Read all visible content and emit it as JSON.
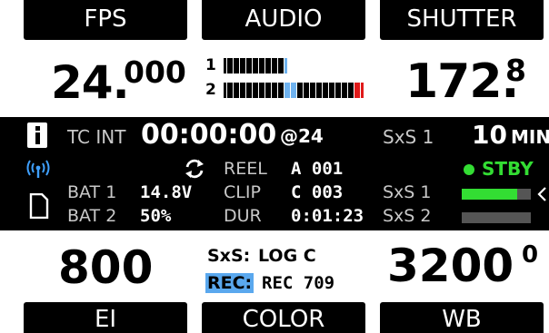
{
  "tabs": {
    "top": [
      "FPS",
      "AUDIO",
      "SHUTTER"
    ],
    "bottom": [
      "EI",
      "COLOR",
      "WB"
    ]
  },
  "fps": {
    "whole": "24.",
    "fraction": "000"
  },
  "shutter": {
    "whole": "172.",
    "fraction": "8"
  },
  "audio": {
    "channels": [
      {
        "label": "1",
        "segments": [
          "k",
          "k",
          "k",
          "k",
          "k",
          "k",
          "k",
          "k",
          "k",
          "k",
          "k",
          "k",
          "k",
          "k",
          "k",
          "k",
          "k",
          "k",
          "k",
          "b"
        ]
      },
      {
        "label": "2",
        "segments": [
          "k",
          "k",
          "k",
          "k",
          "k",
          "k",
          "k",
          "k",
          "k",
          "k",
          "k",
          "k",
          "k",
          "k",
          "k",
          "k",
          "k",
          "k",
          "k",
          "b",
          "b",
          "b",
          "b",
          "k",
          "k",
          "k",
          "k",
          "k",
          "k",
          "k",
          "k",
          "k",
          "k",
          "k",
          "k",
          "k",
          "k",
          "k",
          "k",
          "k",
          "k",
          "r",
          "r",
          "r"
        ]
      }
    ],
    "colors": {
      "k": "#000000",
      "b": "#6fb3f0",
      "r": "#e01a1a"
    }
  },
  "status": {
    "tc_label": "TC INT",
    "timecode": "00:00:00",
    "tc_rate": "@24",
    "media_1_label": "SxS 1",
    "remaining": "10",
    "remaining_unit": "MIN",
    "state": "STBY",
    "state_color": "#33dd33",
    "bat1_label": "BAT 1",
    "bat1_value": "14.8V",
    "bat2_label": "BAT 2",
    "bat2_value": "50%",
    "reel_label": "REEL",
    "reel_value": "A 001",
    "clip_label": "CLIP",
    "clip_value": "C 003",
    "dur_label": "DUR",
    "dur_value": "0:01:23",
    "card1_label": "SxS 1",
    "card2_label": "SxS 2",
    "card1_fill": 0.8,
    "card2_fill": 0.0,
    "wifi_color": "#3fa0ff",
    "info_icon": "info-icon",
    "sd_icon": "sd-card-icon",
    "sync_icon": "sync-icon"
  },
  "ei": {
    "value": "800"
  },
  "color": {
    "sxs_label": "SxS:",
    "sxs_value": "LOG C",
    "rec_label": "REC:",
    "rec_value": "REC 709",
    "rec_highlight": "#5aa8ee"
  },
  "wb": {
    "value": "3200",
    "tint": "0"
  }
}
